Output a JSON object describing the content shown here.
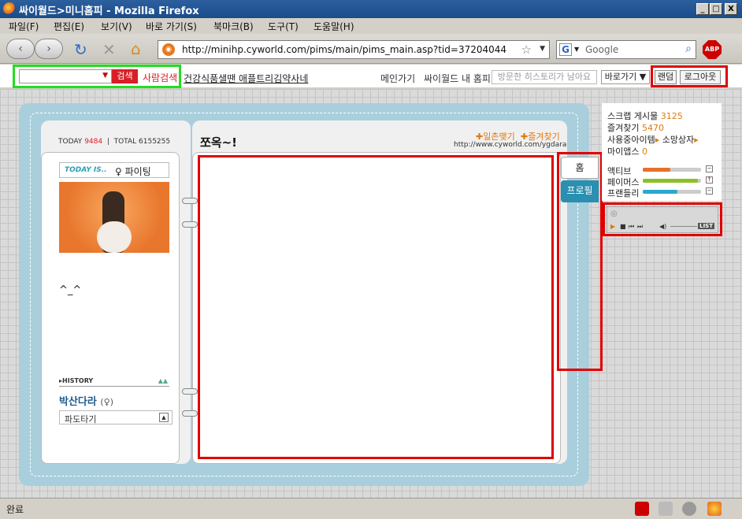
{
  "window": {
    "title": "싸이월드>미니홈피 - Mozilla Firefox",
    "min": "_",
    "max": "□",
    "close": "X"
  },
  "menu": [
    "파일(F)",
    "편집(E)",
    "보기(V)",
    "바로 가기(S)",
    "북마크(B)",
    "도구(T)",
    "도움말(H)"
  ],
  "nav": {
    "url": "http://minihp.cyworld.com/pims/main/pims_main.asp?tid=37204044",
    "search_placeholder": "Google",
    "abp": "ABP"
  },
  "cybar": {
    "search_button": "검색",
    "person_search": "사람검색",
    "ad_text": "건강식품샐땐 애플트리김약사네",
    "main_link": "메인가기",
    "my_home": "싸이월드 내 홈피",
    "visited_placeholder": "방문한 히스토리가 남아요",
    "shortcut": "바로가기",
    "random": "랜덤",
    "logout": "로그아웃"
  },
  "minihp": {
    "today_label": "TODAY",
    "today_count": "9484",
    "total_label": "TOTAL",
    "total_count": "6155255",
    "title": "쪼옥~!",
    "ilchon": "일촌맺기",
    "favorite": "즐겨찾기",
    "homepage_url": "http://www.cyworld.com/ygdara",
    "today_is_label": "TODAY IS..",
    "today_is_value": "♀ 파이팅",
    "message": "^_^",
    "history_label": "HISTORY",
    "owner_name": "박산다라",
    "owner_sex": "(♀)",
    "pado": "파도타기",
    "tab_home": "홈",
    "tab_profile": "프로필"
  },
  "side": {
    "scrap_label": "스크랩 게시물",
    "scrap_count": "3125",
    "fav_label": "즐겨찾기",
    "fav_count": "5470",
    "items_label": "사용중아이템",
    "wish_label": "소망상자",
    "myapps_label": "마이앱스",
    "myapps_count": "0",
    "active_label": "액티브",
    "active_level": 0.47,
    "famous_label": "페이머스",
    "famous_level": 0.95,
    "friendly_label": "프랜들리",
    "friendly_level": 0.6,
    "player_list": "LIST"
  },
  "colors": {
    "active": "#e8702a",
    "famous": "#8cbf26",
    "friendly": "#2aa8d0",
    "cyred": "#d81f26"
  },
  "status": {
    "text": "완료"
  }
}
